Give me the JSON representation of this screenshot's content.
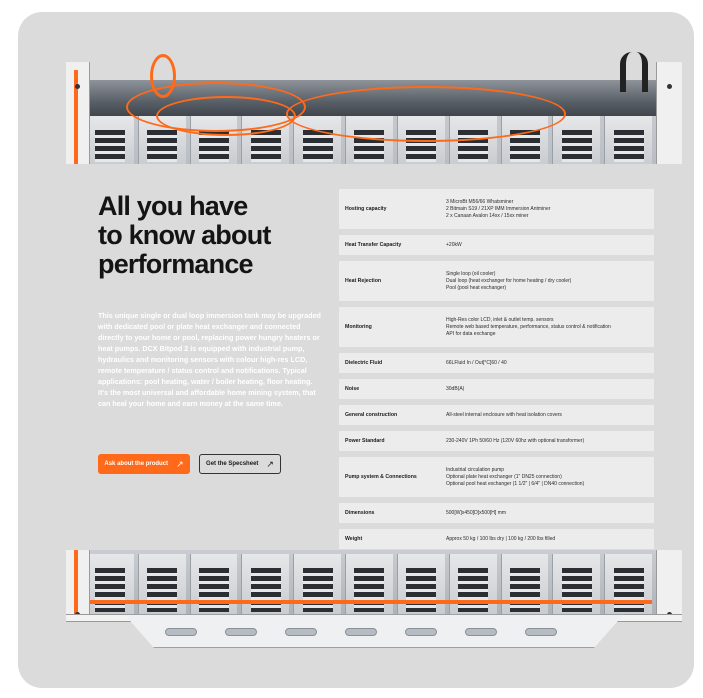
{
  "section": {
    "headline": "All you have\nto know about\nperformance",
    "description": "This unique single or dual loop immersion tank may be upgraded with dedicated pool or plate heat exchanger and connected directly to your home or pool, replacing power hungry heaters or heat pumps. DCX Bitpod 2 is equipped with industrial pump, hydraulics and monitoring sensors with colour high-res LCD, remote temperature / status control and notifications. Typical applications: pool heating, water / boiler heating, floor heating. It's the most universal and affordable home mining system, that can heal your home and earn money at the same time."
  },
  "buttons": {
    "ask_label": "Ask about the product",
    "ask_icon": "arrow-up-right-icon",
    "spec_label": "Get the Specsheet",
    "spec_icon": "arrow-up-right-icon"
  },
  "specs": [
    {
      "label": "Hosting capacity",
      "value": "3 MicroBt M56/66 Whatsminer\n2 Bitmain S19 / 21XP IMM Immersion Antminer\n2 x Canaan Avalon 14xx / 15xx miner"
    },
    {
      "label": "Heat Transfer Capacity",
      "value": "+20kW"
    },
    {
      "label": "Heat Rejection",
      "value": "Single loop (oil cooler)\nDual loop (heat exchanger for home heating / dry cooler)\nPool (pool heat exchanger)"
    },
    {
      "label": "Monitoring",
      "value": "High-Res color LCD, inlet & outlet temp. sensors\nRemote web based temperature, performance, status control & notification\nAPI for data exchange"
    },
    {
      "label": "Dielectric Fluid",
      "value": "66LFluid In / Out[°C]60 / 40"
    },
    {
      "label": "Noise",
      "value": "30dB(A)"
    },
    {
      "label": "General construction",
      "value": "All-steel internal enclosure with heat isolation covers"
    },
    {
      "label": "Power Standard",
      "value": "230-240V 1Ph 50/60 Hz (120V 60hz with optional transformer)"
    },
    {
      "label": "Pump system & Connections",
      "value": "Industrial circulation pump\nOptional plate heat exchanger (1\" DN25 connection)\nOptional pool heat exchanger (1 1/2\" | 6/4\" | DN40 connection)"
    },
    {
      "label": "Dimensions",
      "value": "500[W]x450[D]x500[H] mm"
    },
    {
      "label": "Weight",
      "value": "Approx 50 kg / 100 lbs dry | 100 kg / 200 lbs filled"
    }
  ],
  "colors": {
    "accent": "#ff6a1a",
    "card_background": "#dbdbdb",
    "row_background": "#ececec"
  }
}
